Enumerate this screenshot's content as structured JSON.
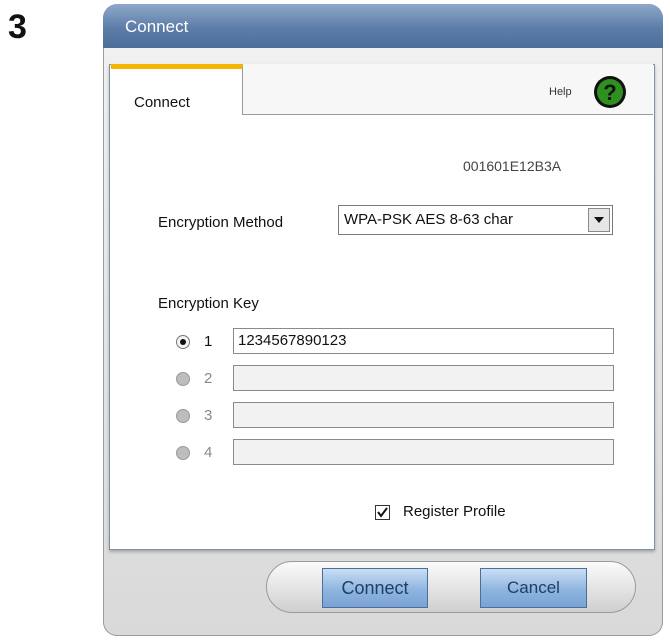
{
  "step_number": "3",
  "window": {
    "title": "Connect"
  },
  "tabs": {
    "active_label": "Connect"
  },
  "help": {
    "label": "Help",
    "icon": "question-mark-icon"
  },
  "device_id": "001601E12B3A",
  "encryption_method": {
    "label": "Encryption Method",
    "selected": "WPA-PSK AES 8-63 char"
  },
  "encryption_key": {
    "label": "Encryption Key",
    "keys": [
      {
        "number": "1",
        "value": "1234567890123",
        "selected": true,
        "enabled": true
      },
      {
        "number": "2",
        "value": "",
        "selected": false,
        "enabled": false
      },
      {
        "number": "3",
        "value": "",
        "selected": false,
        "enabled": false
      },
      {
        "number": "4",
        "value": "",
        "selected": false,
        "enabled": false
      }
    ]
  },
  "register_profile": {
    "label": "Register Profile",
    "checked": true
  },
  "buttons": {
    "connect": "Connect",
    "cancel": "Cancel"
  },
  "colors": {
    "titlebar": "#5c7da8",
    "tab_accent": "#f5b400",
    "button_fill": "#8fb4df",
    "help_icon": "#2f8f1f"
  }
}
